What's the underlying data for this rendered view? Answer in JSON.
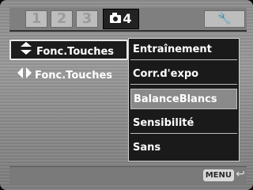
{
  "tabs": [
    {
      "label": "1"
    },
    {
      "label": "2"
    },
    {
      "label": "3"
    },
    {
      "label": "4"
    }
  ],
  "icons": {
    "up_down": "▲▼",
    "left_right": "◀▶",
    "wrench": "🔧",
    "return": "↩"
  },
  "left_menu": [
    {
      "label": "Fonc.Touches"
    },
    {
      "label": "Fonc.Touches"
    }
  ],
  "submenu": [
    {
      "label": "Entraînement"
    },
    {
      "label": "Corr.d'expo"
    },
    {
      "label": "BalanceBlancs"
    },
    {
      "label": "Sensibilité"
    },
    {
      "label": "Sans"
    }
  ],
  "footer": {
    "menu_label": "MENU"
  },
  "colors": {
    "selected_bg": "#1c1c1c",
    "highlight_bg": "#8a8a8a",
    "active_tab_bg": "#222222"
  }
}
